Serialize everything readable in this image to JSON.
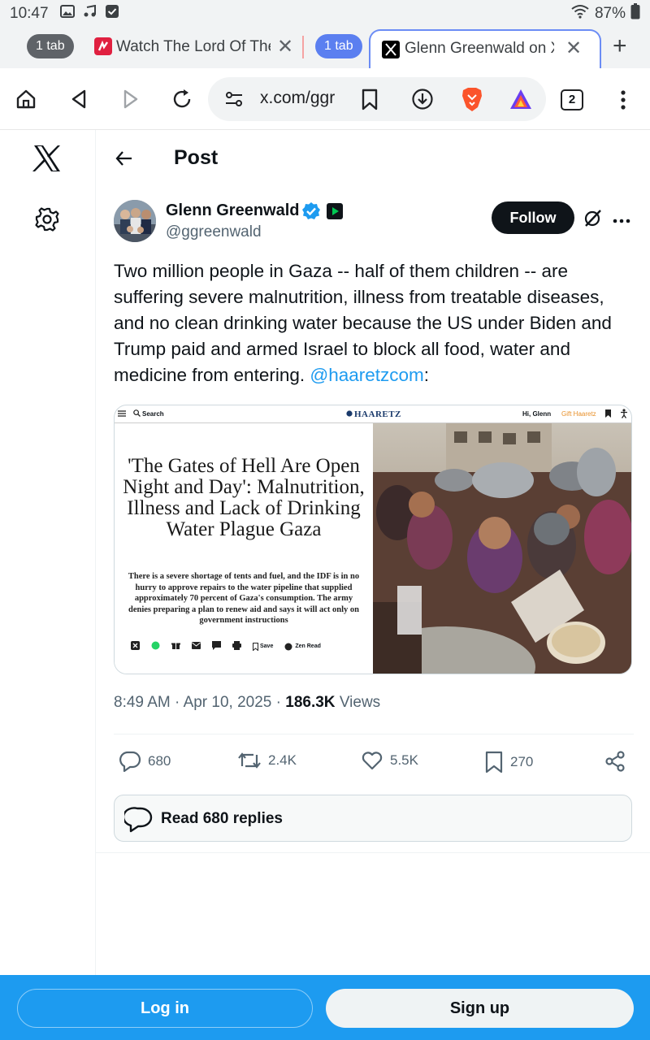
{
  "status_bar": {
    "time": "10:47",
    "battery": "87%"
  },
  "tabs": {
    "group1_count": "1 tab",
    "tab1_title": "Watch The Lord Of The R",
    "group2_count": "1 tab",
    "tab2_title": "Glenn Greenwald on X: \"T"
  },
  "toolbar": {
    "url": "x.com/ggreenwald",
    "tab_count": "2"
  },
  "header": {
    "title": "Post"
  },
  "author": {
    "name": "Glenn Greenwald",
    "handle": "@ggreenwald",
    "follow_label": "Follow"
  },
  "tweet": {
    "text": "Two million people in Gaza -- half of them children -- are suffering severe malnutrition, illness from treatable diseases, and no clean drinking water because the US under Biden and Trump paid and armed Israel to block all food, water and medicine from entering. ",
    "mention": "@haaretzcom",
    "suffix": ":"
  },
  "media": {
    "search_label": "Search",
    "masthead": "HAARETZ",
    "account": "Hi, Glenn",
    "gift": "Gift Haaretz",
    "headline": "'The Gates of Hell Are Open Night and Day': Malnutrition, Illness and Lack of Drinking Water Plague Gaza",
    "dek": "There is a severe shortage of tents and fuel, and the IDF is in no hurry to approve repairs to the water pipeline that supplied approximately 70 percent of Gaza's consumption. The army denies preparing a plan to renew aid and says it will act only on government instructions",
    "save_label": "Save",
    "zen_label": "Zen Read"
  },
  "meta": {
    "time": "8:49 AM",
    "date": "Apr 10, 2025",
    "views": "186.3K",
    "views_label": "Views"
  },
  "actions": {
    "replies": "680",
    "reposts": "2.4K",
    "likes": "5.5K",
    "bookmarks": "270"
  },
  "read_replies": "Read 680 replies",
  "bottom": {
    "login": "Log in",
    "signup": "Sign up"
  },
  "colors": {
    "accent": "#1d9bf0",
    "text": "#0f1419",
    "muted": "#536471"
  }
}
